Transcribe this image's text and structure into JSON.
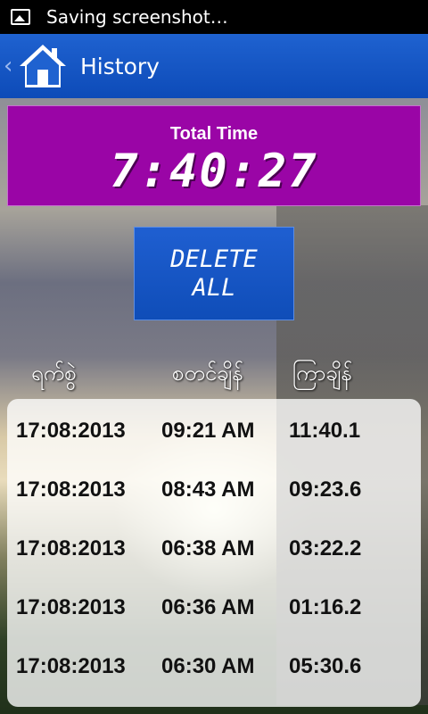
{
  "status_bar": {
    "text": "Saving screenshot…",
    "icon": "image-icon"
  },
  "action_bar": {
    "title": "History",
    "icon": "home-icon"
  },
  "total": {
    "label": "Total Time",
    "value": "7:40:27"
  },
  "delete_button": {
    "label": "DELETE\nALL"
  },
  "columns": {
    "date": "ရက်စွဲ",
    "start": "စတင်ချိန်",
    "duration": "ကြာချိန်"
  },
  "rows": [
    {
      "date": "17:08:2013",
      "start": "09:21 AM",
      "duration": "11:40.1"
    },
    {
      "date": "17:08:2013",
      "start": "08:43 AM",
      "duration": "09:23.6"
    },
    {
      "date": "17:08:2013",
      "start": "06:38 AM",
      "duration": "03:22.2"
    },
    {
      "date": "17:08:2013",
      "start": "06:36 AM",
      "duration": "01:16.2"
    },
    {
      "date": "17:08:2013",
      "start": "06:30 AM",
      "duration": "05:30.6"
    }
  ],
  "colors": {
    "action_bar": "#1f62d0",
    "total_panel": "#9a05a6",
    "delete_button": "#1f5fd1"
  }
}
